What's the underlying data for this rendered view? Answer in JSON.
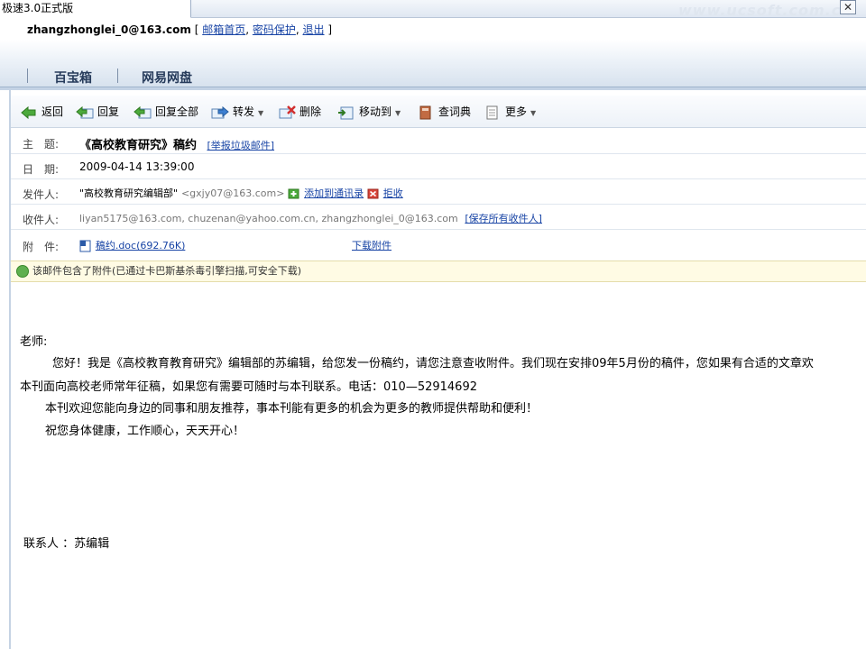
{
  "window": {
    "tab_title": "极速3.0正式版",
    "watermark": "www.ucsoft.com.cn",
    "close_glyph": "✕"
  },
  "account": {
    "email": "zhangzhonglei_0@163.com",
    "open_bracket": "[",
    "links": [
      "邮箱首页",
      "密码保护",
      "退出"
    ],
    "close_bracket": "]"
  },
  "nav": {
    "items": [
      "百宝箱",
      "网易网盘"
    ]
  },
  "toolbar": {
    "back": "返回",
    "reply": "回复",
    "reply_all": "回复全部",
    "forward": "转发",
    "delete": "删除",
    "move_to": "移动到",
    "dictionary": "查词典",
    "more": "更多"
  },
  "header": {
    "subject_label": "主　题:",
    "subject": "《高校教育研究》稿约",
    "report_spam": "[举报垃圾邮件]",
    "date_label": "日　期:",
    "date": "2009-04-14 13:39:00",
    "from_label": "发件人:",
    "from_name": "\"高校教育研究编辑部\"",
    "from_email": "<gxjy07@163.com>",
    "add_contact": "添加到通讯录",
    "reject": "拒收",
    "to_label": "收件人:",
    "to": "liyan5175@163.com, chuzenan@yahoo.com.cn, zhangzhonglei_0@163.com",
    "save_recipients": "[保存所有收件人]",
    "attach_label": "附　件:",
    "attachment": "稿约.doc(692.76K)",
    "download": "下载附件"
  },
  "safety_notice": "该邮件包含了附件(已通过卡巴斯基杀毒引擎扫描,可安全下载)",
  "body": {
    "greeting": "老师:",
    "p1": "您好！我是《高校教育教育研究》编辑部的苏编辑，给您发一份稿约，请您注意查收附件。我们现在安排09年5月份的稿件，您如果有合适的文章欢",
    "p1b": "本刊面向高校老师常年征稿，如果您有需要可随时与本刊联系。电话：010—52914692",
    "p2": "本刊欢迎您能向身边的同事和朋友推荐，事本刊能有更多的机会为更多的教师提供帮助和便利！",
    "p3": "祝您身体健康，工作顺心，天天开心！",
    "contact": "联系人 ：苏编辑"
  }
}
